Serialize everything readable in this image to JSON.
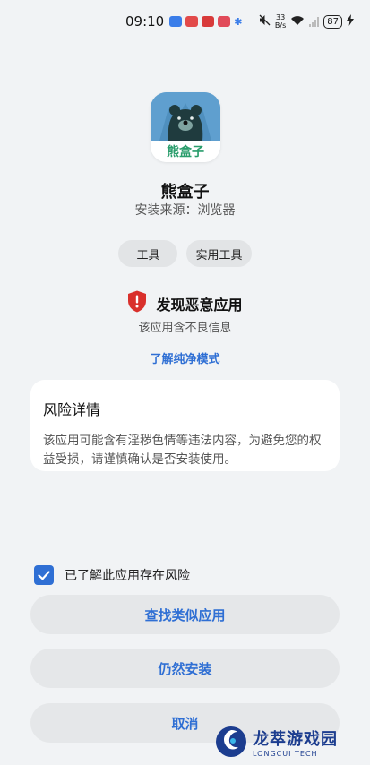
{
  "status_bar": {
    "time": "09:10",
    "speed_value": "33",
    "speed_unit": "B/s",
    "battery": "87"
  },
  "app": {
    "icon_text": "熊盒子",
    "name": "熊盒子",
    "source": "安装来源：浏览器"
  },
  "tags": [
    "工具",
    "实用工具"
  ],
  "warning": {
    "title": "发现恶意应用",
    "subtitle": "该应用含不良信息",
    "link": "了解纯净模式",
    "icon_color": "#d9302c"
  },
  "risk": {
    "title": "风险详情",
    "text": "该应用可能含有淫秽色情等违法内容，为避免您的权益受损，请谨慎确认是否安装使用。"
  },
  "acknowledge": {
    "label": "已了解此应用存在风险",
    "checked": true
  },
  "buttons": {
    "find_similar": "查找类似应用",
    "install_anyway": "仍然安装",
    "cancel": "取消"
  },
  "watermark": {
    "title": "龙萃游戏园",
    "subtitle": "LONGCUI TECH"
  },
  "colors": {
    "accent": "#2f6fd4",
    "background": "#f1f3f5",
    "danger": "#d9302c"
  }
}
